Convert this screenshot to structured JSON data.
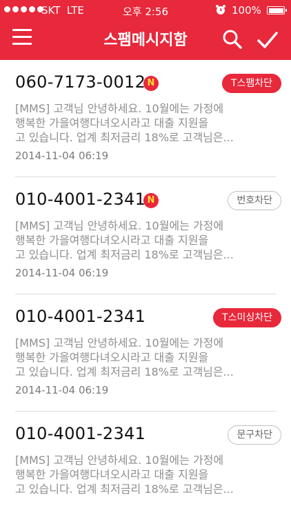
{
  "status_bar": {
    "carrier": "SKT",
    "network": "LTE",
    "time": "오후 2:56",
    "battery": "100%"
  },
  "header": {
    "title": "스팸메시지함",
    "menu_icon": "hamburger-menu-icon",
    "search_icon": "search-icon",
    "confirm_icon": "checkmark-icon"
  },
  "colors": {
    "primary": "#e8283b",
    "badge_text": "#ffdd33",
    "message_text": "#8e8e8e"
  },
  "messages": [
    {
      "number": "060-7173-0012",
      "new_badge": "N",
      "tag": "T스팸차단",
      "tag_style": "red",
      "lines": [
        "[MMS] 고객님 안녕하세요. 10월에는 가정에",
        "행복한 가을여행다녀오시라고 대출 지원을",
        "고 있습니다. 업계 최저금리 18%로 고객님은..."
      ],
      "date": "2014-11-04 06:19"
    },
    {
      "number": "010-4001-2341",
      "new_badge": "N",
      "tag": "번호차단",
      "tag_style": "grey",
      "lines": [
        "[MMS] 고객님 안녕하세요. 10월에는 가정에",
        "행복한 가을여행다녀오시라고 대출 지원을",
        "고 있습니다. 업계 최저금리 18%로 고객님은..."
      ],
      "date": "2014-11-04 06:19"
    },
    {
      "number": "010-4001-2341",
      "new_badge": "",
      "tag": "T스미싱차단",
      "tag_style": "red",
      "lines": [
        "[MMS] 고객님 안녕하세요. 10월에는 가정에",
        "행복한 가을여행다녀오시라고 대출 지원을",
        "고 있습니다. 업계 최저금리 18%로 고객님은..."
      ],
      "date": "2014-11-04 06:19"
    },
    {
      "number": "010-4001-2341",
      "new_badge": "",
      "tag": "문구차단",
      "tag_style": "grey",
      "lines": [
        "[MMS] 고객님 안녕하세요. 10월에는 가정에",
        "행복한 가을여행다녀오시라고 대출 지원을",
        "고 있습니다. 업계 최저금리 18%로 고객님은..."
      ],
      "date": ""
    }
  ]
}
